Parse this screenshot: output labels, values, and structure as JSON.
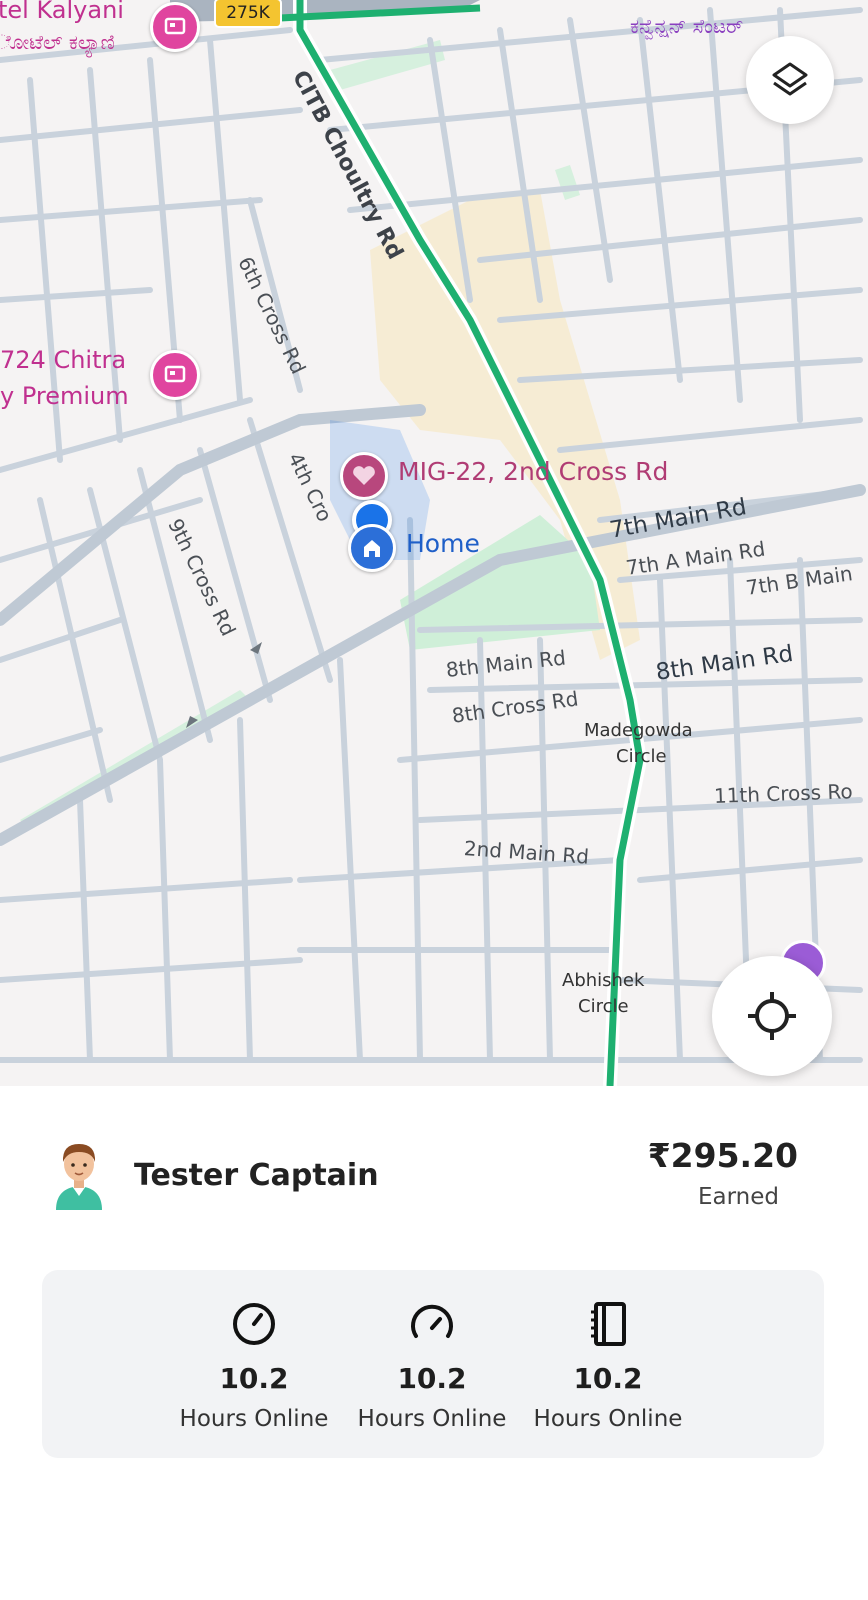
{
  "map": {
    "highway_badge": "275K",
    "poi": {
      "hotel_top": "tel Kalyani",
      "hotel_top_kn": "ೋಟೆಲ್ ಕಲ್ಯಾಣಿ",
      "convention_kn": "ಕನ್ವೆನ್ಷನ್ ಸೆಂಟರ್",
      "hotel_mid_1": "724 Chitra",
      "hotel_mid_2": "y Premium",
      "saved_place": "MIG-22, 2nd Cross Rd",
      "home": "Home"
    },
    "streets": {
      "citb": "CITB Choultry Rd",
      "sixth_cross": "6th Cross Rd",
      "fourth_cross": "4th Cro",
      "ninth_cross": "9th Cross Rd",
      "seventh_main": "7th Main Rd",
      "seventh_a_main": "7th A Main Rd",
      "seventh_b_main": "7th B Main",
      "eighth_main_small": "8th Main Rd",
      "eighth_main": "8th Main Rd",
      "eighth_cross": "8th Cross Rd",
      "madegowda_1": "Madegowda",
      "madegowda_2": "Circle",
      "eleventh_cross": "11th Cross Ro",
      "second_main": "2nd Main Rd",
      "abhishek_1": "Abhishek",
      "abhishek_2": "Circle"
    },
    "colors": {
      "route": "#1eb070",
      "location": "#1a73e8",
      "poi": "#c0308f"
    }
  },
  "driver": {
    "name": "Tester Captain",
    "earnings": "₹295.20",
    "earnings_label": "Earned"
  },
  "stats": [
    {
      "icon": "clock-icon",
      "value": "10.2",
      "label": "Hours Online"
    },
    {
      "icon": "speedometer-icon",
      "value": "10.2",
      "label": "Hours Online"
    },
    {
      "icon": "logbook-icon",
      "value": "10.2",
      "label": "Hours Online"
    }
  ]
}
